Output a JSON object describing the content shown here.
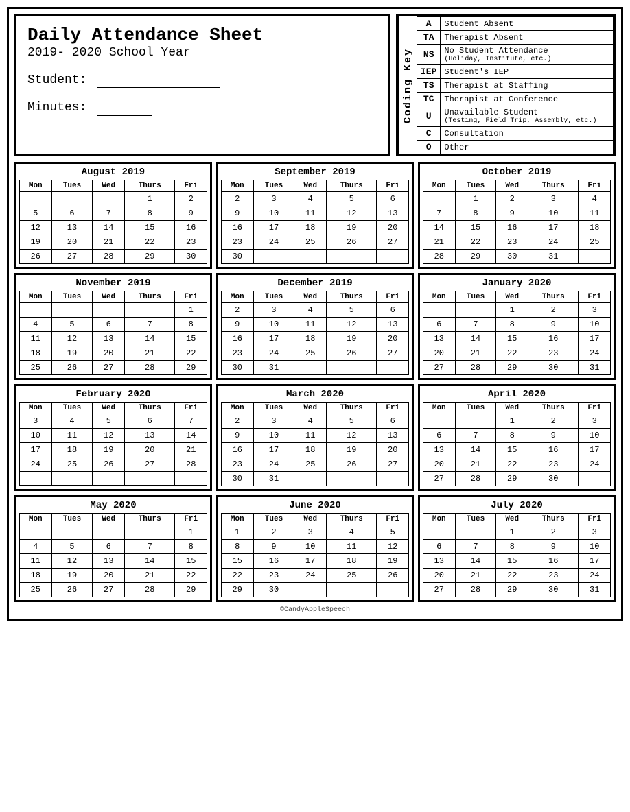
{
  "header": {
    "title": "Daily Attendance Sheet",
    "year": "2019- 2020 School Year",
    "student_label": "Student:",
    "minutes_label": "Minutes:"
  },
  "coding_key": {
    "label": "Coding Key",
    "items": [
      {
        "code": "A",
        "description": "Student Absent",
        "sub": ""
      },
      {
        "code": "TA",
        "description": "Therapist Absent",
        "sub": ""
      },
      {
        "code": "NS",
        "description": "No Student Attendance",
        "sub": "(Holiday, Institute, etc.)"
      },
      {
        "code": "IEP",
        "description": "Student's IEP",
        "sub": ""
      },
      {
        "code": "TS",
        "description": "Therapist at Staffing",
        "sub": ""
      },
      {
        "code": "TC",
        "description": "Therapist at Conference",
        "sub": ""
      },
      {
        "code": "U",
        "description": "Unavailable Student",
        "sub": "(Testing, Field Trip, Assembly, etc.)"
      },
      {
        "code": "C",
        "description": "Consultation",
        "sub": ""
      },
      {
        "code": "O",
        "description": "Other",
        "sub": ""
      }
    ]
  },
  "calendars": [
    {
      "title": "August 2019",
      "headers": [
        "Mon",
        "Tues",
        "Wed",
        "Thurs",
        "Fri"
      ],
      "rows": [
        [
          "",
          "",
          "",
          "1",
          "2"
        ],
        [
          "5",
          "6",
          "7",
          "8",
          "9"
        ],
        [
          "12",
          "13",
          "14",
          "15",
          "16"
        ],
        [
          "19",
          "20",
          "21",
          "22",
          "23"
        ],
        [
          "26",
          "27",
          "28",
          "29",
          "30"
        ]
      ]
    },
    {
      "title": "September 2019",
      "headers": [
        "Mon",
        "Tues",
        "Wed",
        "Thurs",
        "Fri"
      ],
      "rows": [
        [
          "2",
          "3",
          "4",
          "5",
          "6"
        ],
        [
          "9",
          "10",
          "11",
          "12",
          "13"
        ],
        [
          "16",
          "17",
          "18",
          "19",
          "20"
        ],
        [
          "23",
          "24",
          "25",
          "26",
          "27"
        ],
        [
          "30",
          "",
          "",
          "",
          ""
        ]
      ]
    },
    {
      "title": "October 2019",
      "headers": [
        "Mon",
        "Tues",
        "Wed",
        "Thurs",
        "Fri"
      ],
      "rows": [
        [
          "",
          "1",
          "2",
          "3",
          "4"
        ],
        [
          "7",
          "8",
          "9",
          "10",
          "11"
        ],
        [
          "14",
          "15",
          "16",
          "17",
          "18"
        ],
        [
          "21",
          "22",
          "23",
          "24",
          "25"
        ],
        [
          "28",
          "29",
          "30",
          "31",
          ""
        ]
      ]
    },
    {
      "title": "November 2019",
      "headers": [
        "Mon",
        "Tues",
        "Wed",
        "Thurs",
        "Fri"
      ],
      "rows": [
        [
          "",
          "",
          "",
          "",
          "1"
        ],
        [
          "4",
          "5",
          "6",
          "7",
          "8"
        ],
        [
          "11",
          "12",
          "13",
          "14",
          "15"
        ],
        [
          "18",
          "19",
          "20",
          "21",
          "22"
        ],
        [
          "25",
          "26",
          "27",
          "28",
          "29"
        ]
      ]
    },
    {
      "title": "December 2019",
      "headers": [
        "Mon",
        "Tues",
        "Wed",
        "Thurs",
        "Fri"
      ],
      "rows": [
        [
          "2",
          "3",
          "4",
          "5",
          "6"
        ],
        [
          "9",
          "10",
          "11",
          "12",
          "13"
        ],
        [
          "16",
          "17",
          "18",
          "19",
          "20"
        ],
        [
          "23",
          "24",
          "25",
          "26",
          "27"
        ],
        [
          "30",
          "31",
          "",
          "",
          ""
        ]
      ]
    },
    {
      "title": "January 2020",
      "headers": [
        "Mon",
        "Tues",
        "Wed",
        "Thurs",
        "Fri"
      ],
      "rows": [
        [
          "",
          "",
          "1",
          "2",
          "3"
        ],
        [
          "6",
          "7",
          "8",
          "9",
          "10"
        ],
        [
          "13",
          "14",
          "15",
          "16",
          "17"
        ],
        [
          "20",
          "21",
          "22",
          "23",
          "24"
        ],
        [
          "27",
          "28",
          "29",
          "30",
          "31"
        ]
      ]
    },
    {
      "title": "February 2020",
      "headers": [
        "Mon",
        "Tues",
        "Wed",
        "Thurs",
        "Fri"
      ],
      "rows": [
        [
          "3",
          "4",
          "5",
          "6",
          "7"
        ],
        [
          "10",
          "11",
          "12",
          "13",
          "14"
        ],
        [
          "17",
          "18",
          "19",
          "20",
          "21"
        ],
        [
          "24",
          "25",
          "26",
          "27",
          "28"
        ],
        [
          "",
          "",
          "",
          "",
          ""
        ]
      ]
    },
    {
      "title": "March 2020",
      "headers": [
        "Mon",
        "Tues",
        "Wed",
        "Thurs",
        "Fri"
      ],
      "rows": [
        [
          "2",
          "3",
          "4",
          "5",
          "6"
        ],
        [
          "9",
          "10",
          "11",
          "12",
          "13"
        ],
        [
          "16",
          "17",
          "18",
          "19",
          "20"
        ],
        [
          "23",
          "24",
          "25",
          "26",
          "27"
        ],
        [
          "30",
          "31",
          "",
          "",
          ""
        ]
      ]
    },
    {
      "title": "April 2020",
      "headers": [
        "Mon",
        "Tues",
        "Wed",
        "Thurs",
        "Fri"
      ],
      "rows": [
        [
          "",
          "",
          "1",
          "2",
          "3"
        ],
        [
          "6",
          "7",
          "8",
          "9",
          "10"
        ],
        [
          "13",
          "14",
          "15",
          "16",
          "17"
        ],
        [
          "20",
          "21",
          "22",
          "23",
          "24"
        ],
        [
          "27",
          "28",
          "29",
          "30",
          ""
        ]
      ]
    },
    {
      "title": "May 2020",
      "headers": [
        "Mon",
        "Tues",
        "Wed",
        "Thurs",
        "Fri"
      ],
      "rows": [
        [
          "",
          "",
          "",
          "",
          "1"
        ],
        [
          "4",
          "5",
          "6",
          "7",
          "8"
        ],
        [
          "11",
          "12",
          "13",
          "14",
          "15"
        ],
        [
          "18",
          "19",
          "20",
          "21",
          "22"
        ],
        [
          "25",
          "26",
          "27",
          "28",
          "29"
        ]
      ]
    },
    {
      "title": "June 2020",
      "headers": [
        "Mon",
        "Tues",
        "Wed",
        "Thurs",
        "Fri"
      ],
      "rows": [
        [
          "1",
          "2",
          "3",
          "4",
          "5"
        ],
        [
          "8",
          "9",
          "10",
          "11",
          "12"
        ],
        [
          "15",
          "16",
          "17",
          "18",
          "19"
        ],
        [
          "22",
          "23",
          "24",
          "25",
          "26"
        ],
        [
          "29",
          "30",
          "",
          "",
          ""
        ]
      ]
    },
    {
      "title": "July 2020",
      "headers": [
        "Mon",
        "Tues",
        "Wed",
        "Thurs",
        "Fri"
      ],
      "rows": [
        [
          "",
          "",
          "1",
          "2",
          "3"
        ],
        [
          "6",
          "7",
          "8",
          "9",
          "10"
        ],
        [
          "13",
          "14",
          "15",
          "16",
          "17"
        ],
        [
          "20",
          "21",
          "22",
          "23",
          "24"
        ],
        [
          "27",
          "28",
          "29",
          "30",
          "31"
        ]
      ]
    }
  ],
  "copyright": "©CandyAppleSpeech"
}
